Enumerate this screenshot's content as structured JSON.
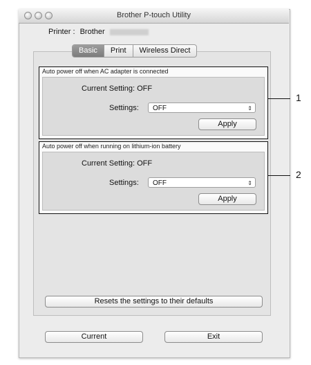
{
  "window": {
    "title": "Brother P-touch Utility"
  },
  "printer": {
    "label": "Printer :",
    "name": "Brother"
  },
  "tabs": [
    {
      "label": "Basic",
      "active": true
    },
    {
      "label": "Print",
      "active": false
    },
    {
      "label": "Wireless Direct",
      "active": false
    }
  ],
  "groups": [
    {
      "title": "Auto power off when AC adapter is connected",
      "current_setting_label": "Current Setting:",
      "current_setting_value": "OFF",
      "settings_label": "Settings:",
      "settings_value": "OFF",
      "apply_label": "Apply"
    },
    {
      "title": "Auto power off when running on lithium-ion battery",
      "current_setting_label": "Current Setting:",
      "current_setting_value": "OFF",
      "settings_label": "Settings:",
      "settings_value": "OFF",
      "apply_label": "Apply"
    }
  ],
  "reset_label": "Resets the settings to their defaults",
  "footer": {
    "current_label": "Current",
    "exit_label": "Exit"
  },
  "callouts": [
    "1",
    "2"
  ],
  "icons": {
    "select_arrows": "⇕"
  }
}
